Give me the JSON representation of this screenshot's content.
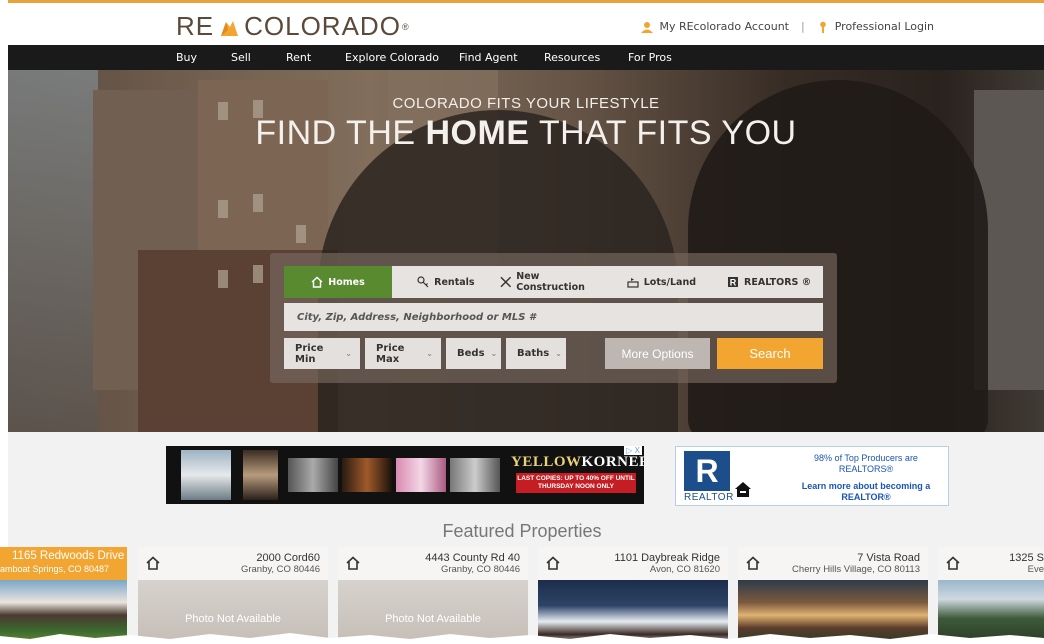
{
  "header": {
    "logo_re": "RE",
    "logo_colorado": "COLORADO",
    "logo_reg": "®",
    "account_link": "My REcolorado Account",
    "pro_link": "Professional Login",
    "brand_color": "#f2a531"
  },
  "nav": {
    "items": [
      "Buy",
      "Sell",
      "Rent",
      "Explore Colorado",
      "Find Agent",
      "Resources",
      "For Pros"
    ]
  },
  "hero": {
    "tagline": "COLORADO FITS YOUR LIFESTYLE",
    "headline_pre": "FIND THE ",
    "headline_bold": "HOME",
    "headline_post": " THAT FITS YOU"
  },
  "search": {
    "tabs": [
      {
        "label": "Homes",
        "icon": "home-icon",
        "active": true
      },
      {
        "label": "Rentals",
        "icon": "key-icon"
      },
      {
        "label": "New Construction",
        "icon": "tools-icon"
      },
      {
        "label": "Lots/Land",
        "icon": "land-icon"
      },
      {
        "label": "REALTORS ®",
        "icon": "realtor-icon"
      }
    ],
    "placeholder": "City, Zip, Address, Neighborhood or MLS #",
    "filters": [
      "Price Min",
      "Price Max",
      "Beds",
      "Baths"
    ],
    "more_label": "More Options",
    "search_label": "Search",
    "search_color": "#f2a531",
    "active_tab_color": "#5a8a2f"
  },
  "ads": {
    "yellowkorner_brand_a": "YELLOW",
    "yellowkorner_brand_b": "KORNER",
    "yellowkorner_promo": "LAST COPIES: UP TO 40% OFF UNTIL THURSDAY NOON ONLY",
    "adchoices": "▷ X",
    "realtor_logo": "R",
    "realtor_word": "REALTOR",
    "realtor_line1": "98% of Top Producers are REALTORS®",
    "realtor_line2": "Learn more about becoming a REALTOR®"
  },
  "featured": {
    "title": "Featured Properties",
    "photo_na": "Photo Not Available",
    "cards": [
      {
        "address": "1165 Redwoods Drive",
        "city": "amboat Springs, CO 80487",
        "photo": "photo"
      },
      {
        "address": "2000 Cord60",
        "city": "Granby, CO 80446",
        "photo": "na"
      },
      {
        "address": "4443 County Rd 40",
        "city": "Granby, CO 80446",
        "photo": "na"
      },
      {
        "address": "1101 Daybreak Ridge",
        "city": "Avon, CO 81620",
        "photo": "photo"
      },
      {
        "address": "7 Vista Road",
        "city": "Cherry Hills Village, CO 80113",
        "photo": "photo"
      },
      {
        "address": "1325 S",
        "city": "Eve",
        "photo": "photo"
      }
    ]
  }
}
